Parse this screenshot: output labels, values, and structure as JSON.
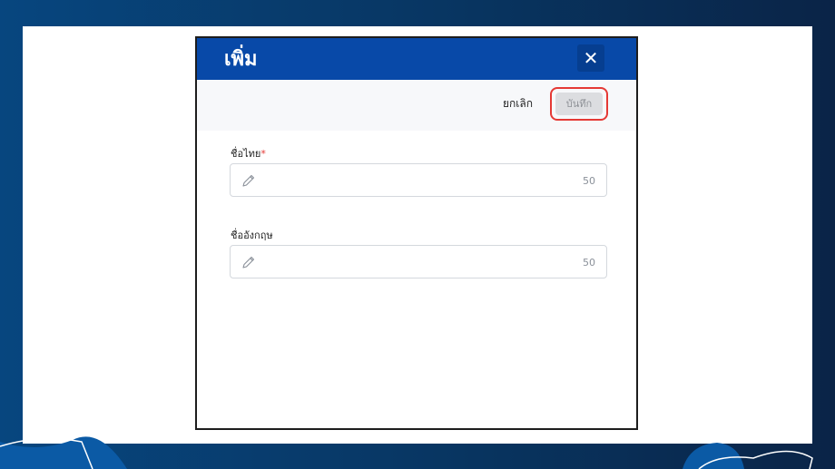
{
  "dialog": {
    "title": "เพิ่ม",
    "close_icon": "close-icon"
  },
  "toolbar": {
    "cancel_label": "ยกเลิก",
    "save_label": "บันทึก",
    "save_state": "disabled",
    "save_highlight_color": "#e53935"
  },
  "fields": [
    {
      "label": "ชื่อไทย",
      "required_mark": "*",
      "icon": "pencil-icon",
      "counter": "50"
    },
    {
      "label": "ชื่ออังกฤษ",
      "icon": "pencil-icon",
      "counter": "50"
    }
  ],
  "colors": {
    "header": "#0849a8",
    "background_gradient": [
      "#07467f",
      "#0a2447"
    ],
    "required": "#e53935"
  }
}
